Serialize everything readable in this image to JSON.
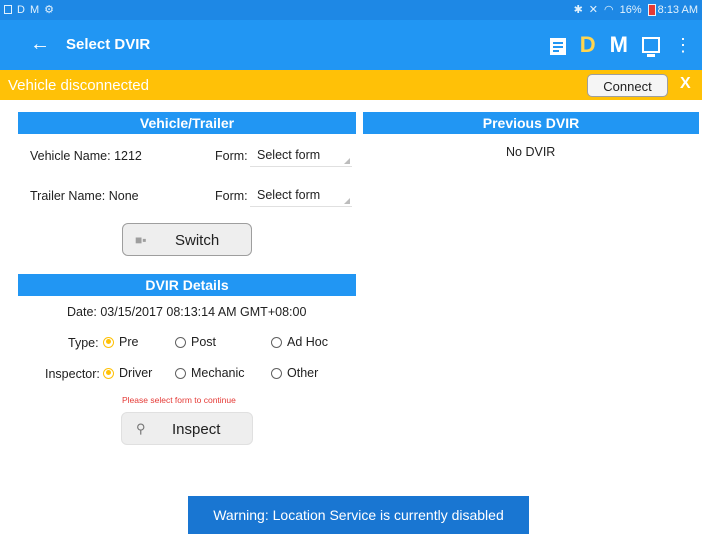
{
  "status_bar": {
    "left_icons": [
      "D",
      "M"
    ],
    "battery_percent": "16%",
    "time": "8:13 AM",
    "icons": [
      "sim-icon",
      "bluetooth-icon",
      "mute-icon",
      "wifi-icon",
      "battery-icon"
    ]
  },
  "app_bar": {
    "back_glyph": "←",
    "title": "Select DVIR",
    "d_label": "D",
    "m_label": "M",
    "more_glyph": "⋮"
  },
  "banner": {
    "text": "Vehicle disconnected",
    "connect_label": "Connect",
    "close_label": "X"
  },
  "vehicle_trailer": {
    "header": "Vehicle/Trailer",
    "vehicle_name": "Vehicle Name: 1212",
    "trailer_name": "Trailer Name: None",
    "form_label": "Form:",
    "form_placeholder": "Select form",
    "switch_label": "Switch"
  },
  "previous_dvir": {
    "header": "Previous DVIR",
    "empty_text": "No DVIR"
  },
  "dvir_details": {
    "header": "DVIR Details",
    "date": "Date: 03/15/2017 08:13:14 AM GMT+08:00",
    "type_label": "Type:",
    "type_options": [
      "Pre",
      "Post",
      "Ad Hoc"
    ],
    "type_selected": "Pre",
    "inspector_label": "Inspector:",
    "inspector_options": [
      "Driver",
      "Mechanic",
      "Other"
    ],
    "inspector_selected": "Driver",
    "error_text": "Please select form to continue",
    "inspect_label": "Inspect"
  },
  "toast": {
    "text": "Warning: Location Service is currently disabled"
  },
  "colors": {
    "primary": "#2196f3",
    "status_bar": "#1e88e5",
    "warning": "#ffc107",
    "error": "#e53935",
    "toast": "#1976d2"
  }
}
